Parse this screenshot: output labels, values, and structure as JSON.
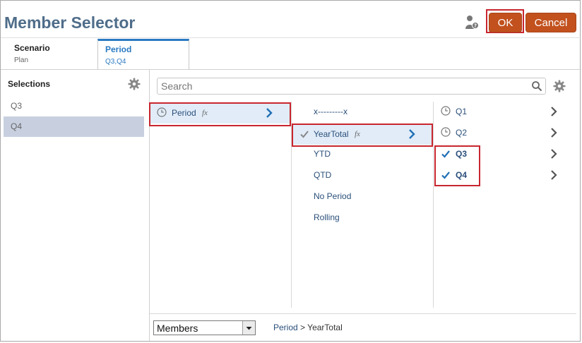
{
  "header": {
    "title": "Member Selector",
    "ok_label": "OK",
    "cancel_label": "Cancel"
  },
  "tabs": [
    {
      "title": "Scenario",
      "sub": "Plan"
    },
    {
      "title": "Period",
      "sub": "Q3,Q4"
    }
  ],
  "selections": {
    "title": "Selections",
    "items": [
      "Q3",
      "Q4"
    ]
  },
  "search": {
    "placeholder": "Search"
  },
  "columns": {
    "col1": [
      {
        "label": "Period",
        "fx": "fx"
      }
    ],
    "col2": [
      {
        "label": "x---------x"
      },
      {
        "label": "YearTotal",
        "fx": "fx"
      },
      {
        "label": "YTD"
      },
      {
        "label": "QTD"
      },
      {
        "label": "No Period"
      },
      {
        "label": "Rolling"
      }
    ],
    "col3": [
      {
        "label": "Q1"
      },
      {
        "label": "Q2"
      },
      {
        "label": "Q3"
      },
      {
        "label": "Q4"
      }
    ]
  },
  "footer": {
    "dropdown_value": "Members",
    "breadcrumb_root": "Period",
    "breadcrumb_sep": ">",
    "breadcrumb_current": "YearTotal"
  },
  "colors": {
    "accent": "#c2511e",
    "highlight": "#c8262f",
    "link": "#2a4f7a",
    "selected_bg": "#e1ecf8"
  }
}
